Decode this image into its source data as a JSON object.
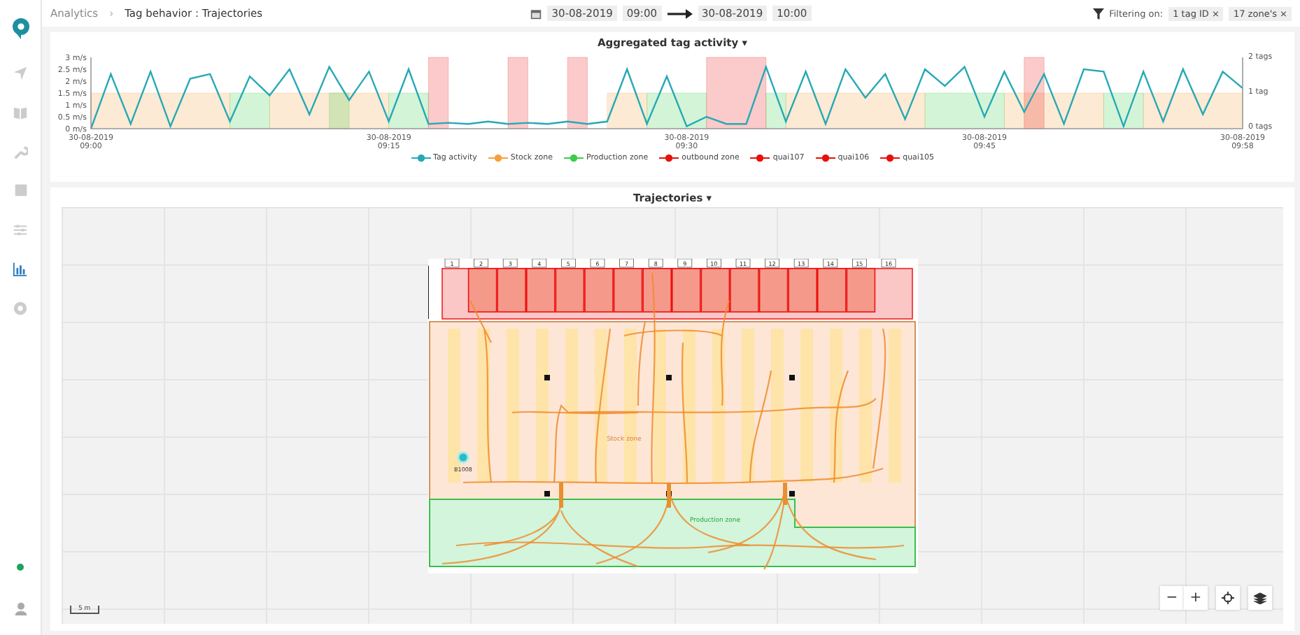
{
  "sidebar": {
    "items": [
      {
        "kind": "navigate",
        "selected": false
      },
      {
        "kind": "book",
        "selected": false
      },
      {
        "kind": "wrench",
        "selected": false
      },
      {
        "kind": "square",
        "selected": false
      },
      {
        "kind": "sliders",
        "selected": false
      },
      {
        "kind": "chart",
        "selected": true
      },
      {
        "kind": "circle",
        "selected": false
      }
    ]
  },
  "breadcrumb": {
    "root": "Analytics",
    "separator": "›",
    "current": "Tag behavior : Trajectories"
  },
  "date_range": {
    "start_date": "30-08-2019",
    "start_time": "09:00",
    "end_date": "30-08-2019",
    "end_time": "10:00"
  },
  "filters": {
    "label": "Filtering on:",
    "chips": [
      {
        "label": "1 tag ID",
        "remove": "×"
      },
      {
        "label": "17 zone's",
        "remove": "×"
      }
    ]
  },
  "activity_panel": {
    "title": "Aggregated tag activity",
    "caret": "▾",
    "right_axis_labels": [
      "2 tags",
      "1 tag",
      "0 tags"
    ],
    "chart_data": {
      "type": "line",
      "categories": [
        "30-08-2019 09:00",
        null,
        null,
        null,
        null,
        null,
        null,
        null,
        null,
        null,
        null,
        null,
        null,
        null,
        null,
        "30-08-2019 09:15",
        null,
        null,
        null,
        null,
        null,
        null,
        null,
        null,
        null,
        null,
        null,
        null,
        null,
        null,
        "30-08-2019 09:30",
        null,
        null,
        null,
        null,
        null,
        null,
        null,
        null,
        null,
        null,
        null,
        null,
        null,
        null,
        "30-08-2019 09:45",
        null,
        null,
        null,
        null,
        null,
        null,
        null,
        null,
        null,
        null,
        null,
        null,
        "30-08-2019 09:58"
      ],
      "ylim": [
        0,
        3
      ],
      "yticks": [
        {
          "value": 0,
          "label": "0 m/s"
        },
        {
          "value": 0.5,
          "label": "0.5 m/s"
        },
        {
          "value": 1,
          "label": "1 m/s"
        },
        {
          "value": 1.5,
          "label": "1.5 m/s"
        },
        {
          "value": 2,
          "label": "2 m/s"
        },
        {
          "value": 2.5,
          "label": "2.5 m/s"
        },
        {
          "value": 3,
          "label": "3 m/s"
        }
      ],
      "series": [
        {
          "name": "Tag activity",
          "color": "#26a9b5",
          "values": [
            0,
            2.3,
            0.2,
            2.4,
            0.1,
            2.1,
            2.3,
            0.3,
            2.2,
            1.4,
            2.5,
            0.6,
            2.6,
            1.2,
            2.4,
            0.3,
            2.5,
            0.2,
            0.25,
            0.2,
            0.3,
            0.2,
            0.25,
            0.2,
            0.3,
            0.2,
            0.3,
            2.5,
            0.2,
            2.2,
            0.1,
            0.5,
            0.2,
            0.2,
            2.6,
            0.3,
            2.4,
            0.2,
            2.5,
            1.3,
            2.3,
            0.4,
            2.5,
            1.8,
            2.6,
            0.5,
            2.4,
            0.7,
            2.3,
            0.2,
            2.5,
            2.4,
            0.1,
            2.4,
            0.3,
            2.5,
            0.6,
            2.4,
            1.7
          ]
        },
        {
          "name": "Stock zone",
          "color": "#f5a03c",
          "type": "area",
          "values": [
            1.5,
            1.5,
            1.5,
            1.5,
            1.5,
            1.5,
            1.5,
            1.5,
            null,
            1.5,
            1.5,
            1.5,
            1.5,
            1.5,
            1.5,
            1.5,
            null,
            null,
            null,
            null,
            null,
            null,
            null,
            null,
            null,
            null,
            1.5,
            1.5,
            1.5,
            null,
            null,
            null,
            null,
            null,
            null,
            1.5,
            1.5,
            1.5,
            1.5,
            1.5,
            1.5,
            1.5,
            1.5,
            null,
            null,
            null,
            1.5,
            1.5,
            1.5,
            1.5,
            1.5,
            1.5,
            null,
            1.5,
            1.5,
            1.5,
            1.5,
            1.5,
            1.5
          ]
        },
        {
          "name": "Production zone",
          "color": "#3dcc4a",
          "type": "area",
          "values": [
            null,
            null,
            null,
            null,
            null,
            null,
            null,
            1.5,
            1.5,
            1.5,
            null,
            null,
            1.5,
            1.5,
            null,
            1.5,
            1.5,
            1.5,
            null,
            null,
            null,
            null,
            null,
            null,
            null,
            null,
            null,
            null,
            1.5,
            1.5,
            1.5,
            1.5,
            null,
            null,
            1.5,
            1.5,
            null,
            null,
            null,
            null,
            null,
            null,
            1.5,
            1.5,
            1.5,
            1.5,
            1.5,
            null,
            null,
            null,
            null,
            1.5,
            1.5,
            1.5,
            null,
            null,
            null,
            null,
            null
          ]
        },
        {
          "name": "outbound zone",
          "color": "#e8100c",
          "type": "area",
          "values": [
            null,
            null,
            null,
            null,
            null,
            null,
            null,
            null,
            null,
            null,
            null,
            null,
            null,
            null,
            null,
            null,
            null,
            null,
            null,
            null,
            null,
            null,
            null,
            null,
            null,
            null,
            null,
            null,
            null,
            null,
            null,
            3,
            3,
            3,
            3,
            null,
            null,
            null,
            null,
            null,
            null,
            null,
            null,
            null,
            null,
            null,
            null,
            null,
            null,
            null,
            null,
            null,
            null,
            null,
            null,
            null,
            null,
            null,
            null
          ]
        },
        {
          "name": "quai107",
          "color": "#e8100c",
          "type": "area",
          "values": [
            null,
            null,
            null,
            null,
            null,
            null,
            null,
            null,
            null,
            null,
            null,
            null,
            null,
            null,
            null,
            null,
            null,
            3,
            3,
            null,
            null,
            3,
            3,
            null,
            null,
            null,
            null,
            null,
            null,
            null,
            null,
            null,
            null,
            null,
            null,
            null,
            null,
            null,
            null,
            null,
            null,
            null,
            null,
            null,
            null,
            null,
            null,
            null,
            null,
            null,
            null,
            null,
            null,
            null,
            null,
            null,
            null,
            null,
            null
          ]
        },
        {
          "name": "quai106",
          "color": "#e8100c",
          "type": "area",
          "values": [
            null,
            null,
            null,
            null,
            null,
            null,
            null,
            null,
            null,
            null,
            null,
            null,
            null,
            null,
            null,
            null,
            null,
            null,
            null,
            null,
            null,
            null,
            null,
            null,
            3,
            3,
            null,
            null,
            null,
            null,
            null,
            null,
            null,
            null,
            null,
            null,
            null,
            null,
            null,
            null,
            null,
            null,
            null,
            null,
            null,
            null,
            null,
            null,
            null,
            null,
            null,
            null,
            null,
            null,
            null,
            null,
            null,
            null,
            null
          ]
        },
        {
          "name": "quai105",
          "color": "#e8100c",
          "type": "area",
          "values": [
            null,
            null,
            null,
            null,
            null,
            null,
            null,
            null,
            null,
            null,
            null,
            null,
            null,
            null,
            null,
            null,
            null,
            null,
            null,
            null,
            null,
            null,
            null,
            null,
            null,
            null,
            null,
            null,
            null,
            null,
            null,
            null,
            null,
            null,
            null,
            null,
            null,
            null,
            null,
            null,
            null,
            null,
            null,
            null,
            null,
            null,
            null,
            3,
            3,
            null,
            null,
            null,
            null,
            null,
            null,
            null,
            null,
            null,
            null
          ]
        }
      ]
    }
  },
  "map_panel": {
    "title": "Trajectories",
    "caret": "▾",
    "docks": [
      "1",
      "2",
      "3",
      "4",
      "5",
      "6",
      "7",
      "8",
      "9",
      "10",
      "11",
      "12",
      "13",
      "14",
      "15",
      "16"
    ],
    "stock_zone_label": "Stock zone",
    "production_zone_label": "Production zone",
    "tag_label": "B1008",
    "scale": "5 m",
    "controls": [
      {
        "kind": "zoom-out",
        "label": "−"
      },
      {
        "kind": "zoom-in",
        "label": "+"
      },
      {
        "kind": "locate"
      },
      {
        "kind": "layers"
      }
    ]
  }
}
